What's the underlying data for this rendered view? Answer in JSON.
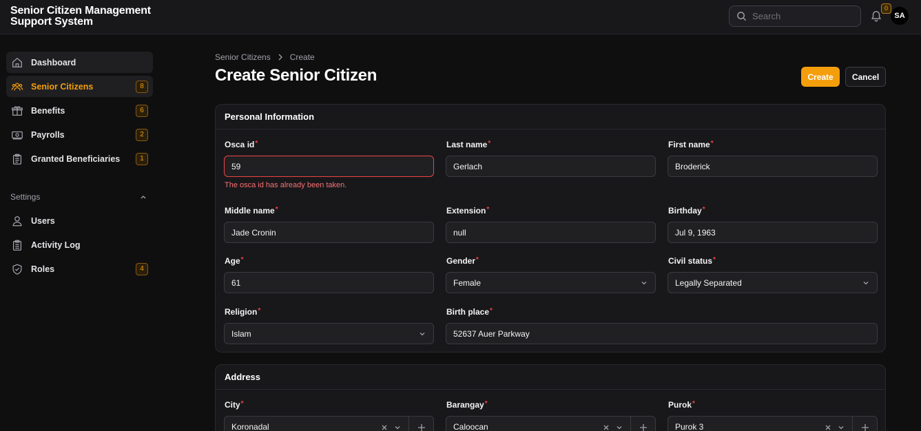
{
  "app": {
    "title": "Senior Citizen Management Support System"
  },
  "topbar": {
    "search_placeholder": "Search",
    "notification_count": "0",
    "avatar_initials": "SA"
  },
  "sidebar": {
    "items": [
      {
        "label": "Dashboard",
        "icon": "home-icon"
      },
      {
        "label": "Senior Citizens",
        "icon": "users-group-icon",
        "badge": "8"
      },
      {
        "label": "Benefits",
        "icon": "gift-icon",
        "badge": "6"
      },
      {
        "label": "Payrolls",
        "icon": "banknote-icon",
        "badge": "2"
      },
      {
        "label": "Granted Beneficiaries",
        "icon": "clipboard-icon",
        "badge": "1"
      }
    ],
    "settings_label": "Settings",
    "settings_items": [
      {
        "label": "Users",
        "icon": "user-icon"
      },
      {
        "label": "Activity Log",
        "icon": "clipboard-list-icon"
      },
      {
        "label": "Roles",
        "icon": "shield-check-icon",
        "badge": "4"
      }
    ]
  },
  "breadcrumb": {
    "parent": "Senior Citizens",
    "current": "Create"
  },
  "page": {
    "title": "Create Senior Citizen",
    "create_label": "Create",
    "cancel_label": "Cancel"
  },
  "personal": {
    "heading": "Personal Information",
    "osca_id": {
      "label": "Osca id",
      "value": "59",
      "error": "The osca id has already been taken."
    },
    "last_name": {
      "label": "Last name",
      "value": "Gerlach"
    },
    "first_name": {
      "label": "First name",
      "value": "Broderick"
    },
    "middle_name": {
      "label": "Middle name",
      "value": "Jade Cronin"
    },
    "extension": {
      "label": "Extension",
      "value": "null"
    },
    "birthday": {
      "label": "Birthday",
      "value": "Jul 9, 1963"
    },
    "age": {
      "label": "Age",
      "value": "61"
    },
    "gender": {
      "label": "Gender",
      "value": "Female"
    },
    "civil_status": {
      "label": "Civil status",
      "value": "Legally Separated"
    },
    "religion": {
      "label": "Religion",
      "value": "Islam"
    },
    "birth_place": {
      "label": "Birth place",
      "value": "52637 Auer Parkway"
    }
  },
  "address": {
    "heading": "Address",
    "city": {
      "label": "City",
      "value": "Koronadal"
    },
    "barangay": {
      "label": "Barangay",
      "value": "Caloocan"
    },
    "purok": {
      "label": "Purok",
      "value": "Purok 3"
    }
  },
  "colors": {
    "accent": "#f59e0b",
    "error": "#ef4444",
    "background": "#0f0f10",
    "panel": "#18181b"
  }
}
